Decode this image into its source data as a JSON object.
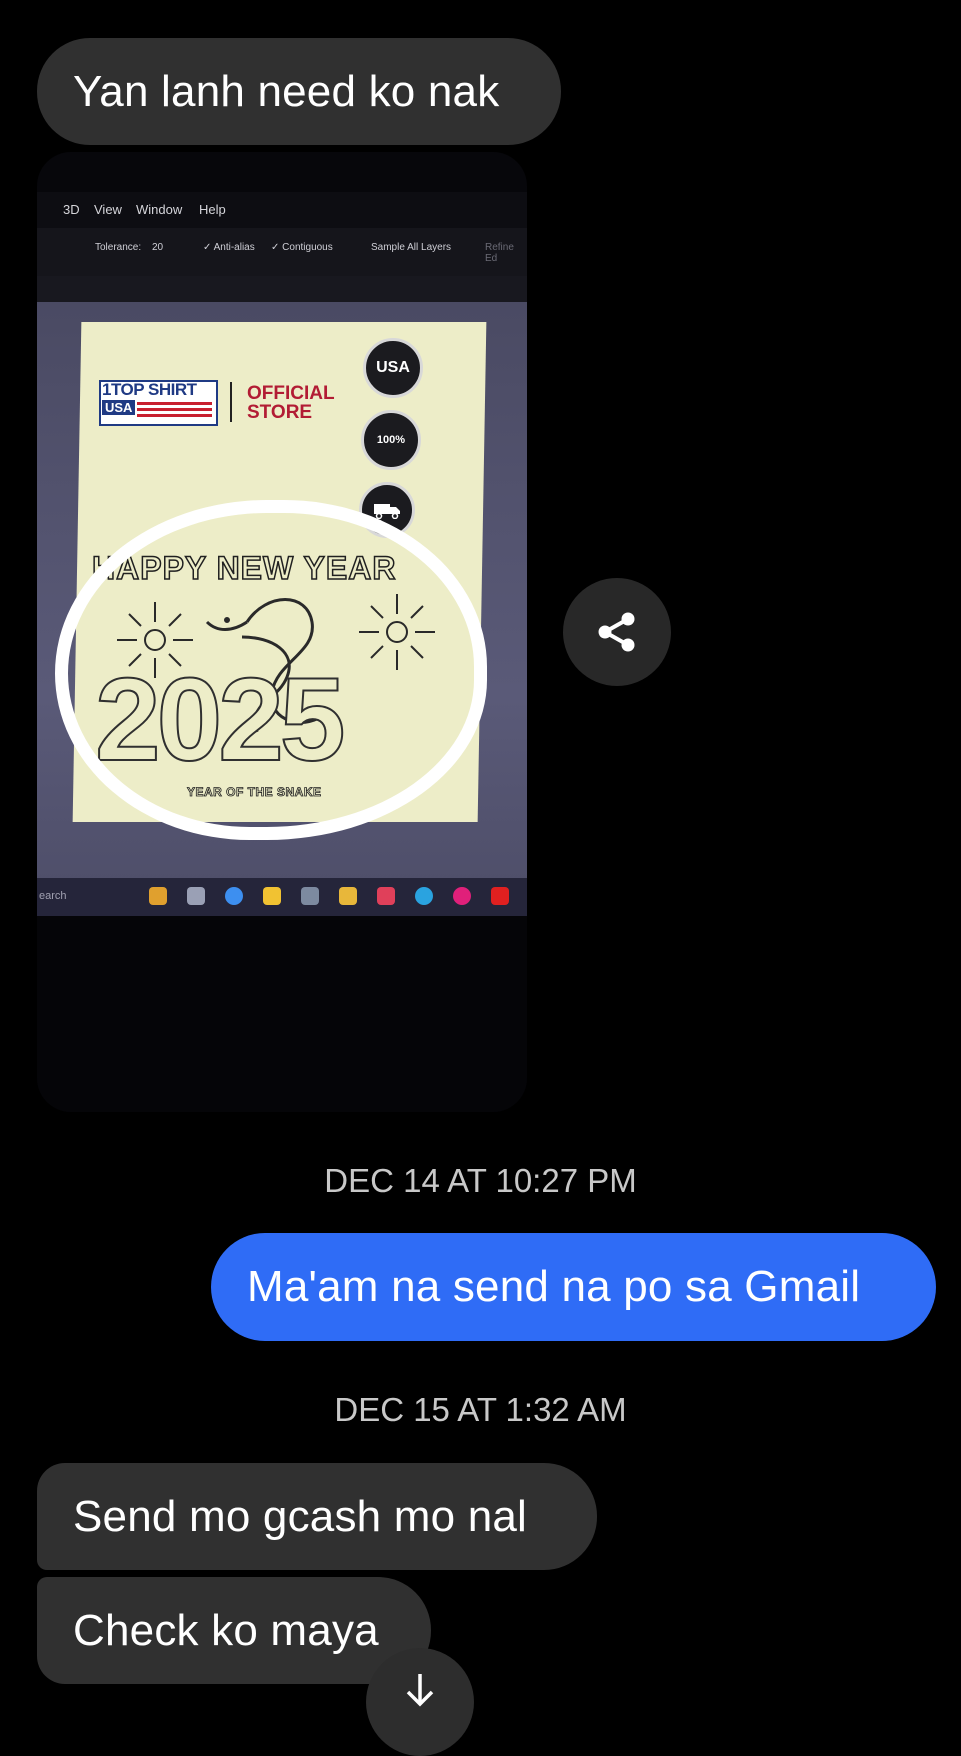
{
  "colors": {
    "incoming_bubble": "#303030",
    "outgoing_bubble": "#2f6cf6",
    "timestamp_text": "#c8c8c8",
    "background": "#000000"
  },
  "messages": [
    {
      "direction": "incoming",
      "text": "Yan lanh need ko nak"
    },
    {
      "direction": "incoming",
      "type": "photo"
    },
    {
      "direction": "outgoing",
      "text": "Ma'am na send na po sa Gmail"
    },
    {
      "direction": "incoming",
      "text": "Send mo gcash mo nal"
    },
    {
      "direction": "incoming",
      "text": "Check ko maya"
    }
  ],
  "timestamps": [
    "DEC 14 AT 10:27 PM",
    "DEC 15 AT 1:32 AM"
  ],
  "photo": {
    "menu": [
      "3D",
      "View",
      "Window",
      "Help"
    ],
    "options": [
      "Tolerance:",
      "20",
      "✓ Anti-alias",
      "✓ Contiguous",
      "Sample All Layers",
      "Refine Ed"
    ],
    "logo_main": "1TOP SHIRT",
    "logo_usa": "USA",
    "official_line1": "OFFICIAL",
    "official_line2": "STORE",
    "badge_usa": "USA",
    "badge_100": "100%",
    "headline": "HAPPY NEW YEAR",
    "year": "2025",
    "subline": "YEAR OF THE SNAKE",
    "search_text": "earch"
  },
  "icons": {
    "share": "share-icon",
    "scroll_down": "arrow-down-icon"
  }
}
